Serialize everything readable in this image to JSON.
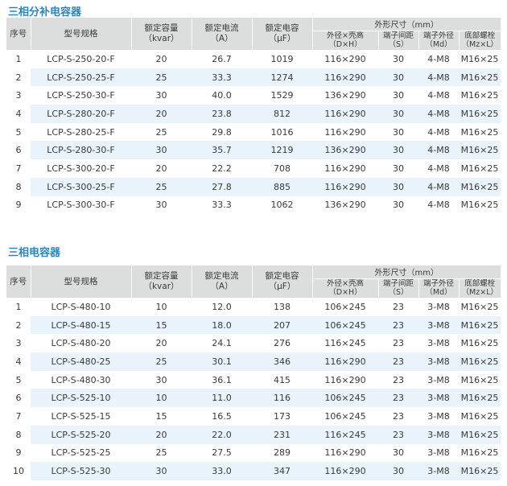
{
  "sections": [
    {
      "title": "三相分补电容器",
      "header": {
        "index": "序号",
        "model": "型号规格",
        "capacity": [
          "额定容量",
          "（kvar）"
        ],
        "current": [
          "额定电流",
          "（A）"
        ],
        "capacitance": [
          "额定电容",
          "（μF）"
        ],
        "dimensions": "外形尺寸（mm）",
        "dim_cols": [
          [
            "外径×壳高",
            "（D×H）"
          ],
          [
            "端子间距",
            "（S）"
          ],
          [
            "端子外径",
            "（Md）"
          ],
          [
            "底部螺栓",
            "（Mz×L）"
          ]
        ]
      },
      "rows": [
        [
          "1",
          "LCP-S-250-20-F",
          "20",
          "26.7",
          "1019",
          "116×290",
          "30",
          "4-M8",
          "M16×25"
        ],
        [
          "2",
          "LCP-S-250-25-F",
          "25",
          "33.3",
          "1274",
          "116×290",
          "30",
          "4-M8",
          "M16×25"
        ],
        [
          "3",
          "LCP-S-250-30-F",
          "30",
          "40.0",
          "1529",
          "136×290",
          "30",
          "4-M8",
          "M16×25"
        ],
        [
          "4",
          "LCP-S-280-20-F",
          "20",
          "23.8",
          "812",
          "116×290",
          "30",
          "4-M8",
          "M16×25"
        ],
        [
          "5",
          "LCP-S-280-25-F",
          "25",
          "29.8",
          "1016",
          "116×290",
          "30",
          "4-M8",
          "M16×25"
        ],
        [
          "6",
          "LCP-S-280-30-F",
          "30",
          "35.7",
          "1219",
          "136×290",
          "30",
          "4-M8",
          "M16×25"
        ],
        [
          "7",
          "LCP-S-300-20-F",
          "20",
          "22.2",
          "708",
          "116×290",
          "30",
          "4-M8",
          "M16×25"
        ],
        [
          "8",
          "LCP-S-300-25-F",
          "25",
          "27.8",
          "885",
          "116×290",
          "30",
          "4-M8",
          "M16×25"
        ],
        [
          "9",
          "LCP-S-300-30-F",
          "30",
          "33.3",
          "1062",
          "136×290",
          "30",
          "4-M8",
          "M16×25"
        ]
      ]
    },
    {
      "title": "三相电容器",
      "header": {
        "index": "序号",
        "model": "型号规格",
        "capacity": [
          "额定容量",
          "（kvar）"
        ],
        "current": [
          "额定电流",
          "（A）"
        ],
        "capacitance": [
          "额定电容",
          "（μF）"
        ],
        "dimensions": "外形尺寸（mm）",
        "dim_cols": [
          [
            "外径×壳高",
            "（D×H）"
          ],
          [
            "端子间距",
            "（S）"
          ],
          [
            "端子外径",
            "（Md）"
          ],
          [
            "底部螺栓",
            "（Mz×L）"
          ]
        ]
      },
      "rows": [
        [
          "1",
          "LCP-S-480-10",
          "10",
          "12.0",
          "138",
          "106×245",
          "23",
          "3-M8",
          "M16×25"
        ],
        [
          "2",
          "LCP-S-480-15",
          "15",
          "18.0",
          "207",
          "106×245",
          "23",
          "3-M8",
          "M16×25"
        ],
        [
          "3",
          "LCP-S-480-20",
          "20",
          "24.1",
          "276",
          "116×245",
          "23",
          "3-M8",
          "M16×25"
        ],
        [
          "4",
          "LCP-S-480-25",
          "25",
          "30.1",
          "346",
          "116×290",
          "23",
          "3-M8",
          "M16×25"
        ],
        [
          "5",
          "LCP-S-480-30",
          "30",
          "36.1",
          "415",
          "116×290",
          "23",
          "3-M8",
          "M16×25"
        ],
        [
          "6",
          "LCP-S-525-10",
          "10",
          "11.0",
          "116",
          "106×245",
          "23",
          "3-M8",
          "M16×25"
        ],
        [
          "7",
          "LCP-S-525-15",
          "15",
          "16.5",
          "173",
          "106×245",
          "23",
          "3-M8",
          "M16×25"
        ],
        [
          "8",
          "LCP-S-525-20",
          "20",
          "22.0",
          "231",
          "116×245",
          "23",
          "3-M8",
          "M16×25"
        ],
        [
          "9",
          "LCP-S-525-25",
          "25",
          "27.5",
          "289",
          "116×290",
          "30",
          "3-M8",
          "M16×25"
        ],
        [
          "10",
          "LCP-S-525-30",
          "30",
          "33.0",
          "347",
          "116×290",
          "30",
          "3-M8",
          "M16×25"
        ]
      ]
    }
  ]
}
